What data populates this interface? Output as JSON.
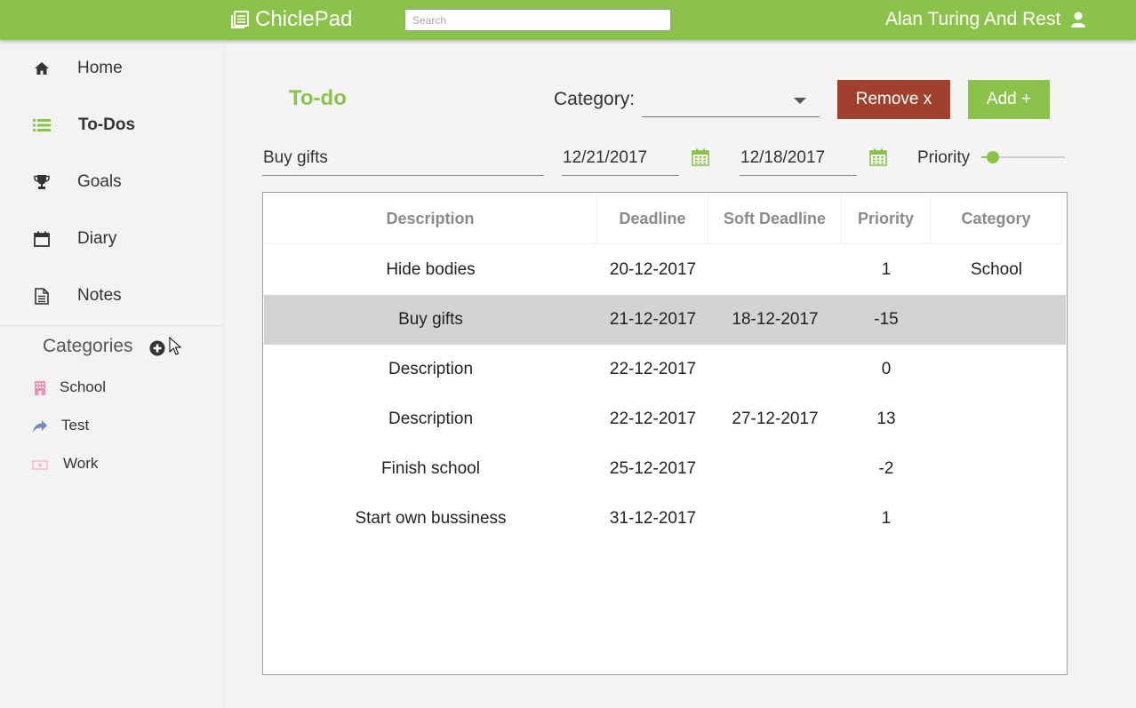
{
  "app": {
    "title": "ChiclePad",
    "search_placeholder": "Search",
    "user_name": "Alan Turing And Rest"
  },
  "sidebar": {
    "items": [
      {
        "label": "Home",
        "icon": "home-icon"
      },
      {
        "label": "To-Dos",
        "icon": "list-icon",
        "active": true
      },
      {
        "label": "Goals",
        "icon": "trophy-icon"
      },
      {
        "label": "Diary",
        "icon": "calendar-icon"
      },
      {
        "label": "Notes",
        "icon": "document-icon"
      }
    ],
    "categories_title": "Categories",
    "categories": [
      {
        "label": "School",
        "icon": "building-icon",
        "color": "#f48fb1"
      },
      {
        "label": "Test",
        "icon": "share-icon",
        "color": "#7986cb"
      },
      {
        "label": "Work",
        "icon": "money-icon",
        "color": "#f8bbd0"
      }
    ]
  },
  "main": {
    "title": "To-do",
    "category_label": "Category:",
    "category_value": "",
    "remove_label": "Remove x",
    "add_label": "Add +",
    "form": {
      "description": "Buy gifts",
      "deadline": "12/21/2017",
      "soft_deadline": "12/18/2017",
      "priority_label": "Priority",
      "priority_level": 0.14
    },
    "table": {
      "headers": [
        "Description",
        "Deadline",
        "Soft Deadline",
        "Priority",
        "Category"
      ],
      "rows": [
        {
          "description": "Hide bodies",
          "deadline": "20-12-2017",
          "soft_deadline": "",
          "priority": "1",
          "category": "School"
        },
        {
          "description": "Buy gifts",
          "deadline": "21-12-2017",
          "soft_deadline": "18-12-2017",
          "priority": "-15",
          "category": "",
          "selected": true
        },
        {
          "description": "Description",
          "deadline": "22-12-2017",
          "soft_deadline": "",
          "priority": "0",
          "category": ""
        },
        {
          "description": "Description",
          "deadline": "22-12-2017",
          "soft_deadline": "27-12-2017",
          "priority": "13",
          "category": ""
        },
        {
          "description": "Finish school",
          "deadline": "25-12-2017",
          "soft_deadline": "",
          "priority": "-2",
          "category": ""
        },
        {
          "description": "Start own bussiness",
          "deadline": "31-12-2017",
          "soft_deadline": "",
          "priority": "1",
          "category": ""
        }
      ]
    }
  },
  "colors": {
    "accent": "#8bc34a",
    "danger": "#a0412d",
    "selected_row": "#d3d3d3"
  }
}
